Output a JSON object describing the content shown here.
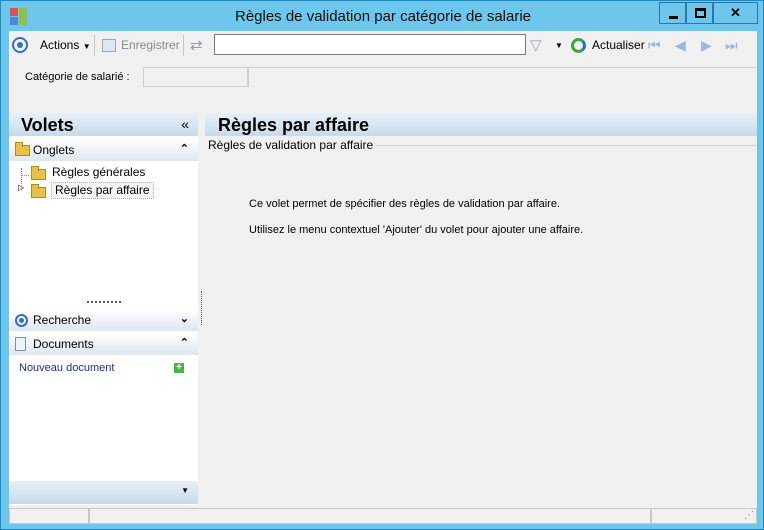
{
  "window": {
    "title": "Règles de validation par catégorie de salarie"
  },
  "toolbar": {
    "actions_label": "Actions",
    "save_label": "Enregistrer",
    "search_value": "",
    "refresh_label": "Actualiser"
  },
  "params": {
    "category_label": "Catégorie de salarié :"
  },
  "left_panel": {
    "title": "Volets",
    "tabs_section": "Onglets",
    "tree": [
      {
        "label": "Règles générales"
      },
      {
        "label": "Règles par affaire"
      }
    ],
    "search_section": "Recherche",
    "documents_section": "Documents",
    "new_document": "Nouveau document"
  },
  "right_panel": {
    "title": "Règles par affaire",
    "group_label": "Règles de validation par affaire",
    "info_line_1": "Ce volet permet de spécifier des règles de validation par affaire.",
    "info_line_2": "Utilisez le menu contextuel 'Ajouter' du volet pour ajouter une affaire."
  },
  "colors": {
    "window_frame": "#6ec6ec",
    "link": "#1b2f8a"
  }
}
